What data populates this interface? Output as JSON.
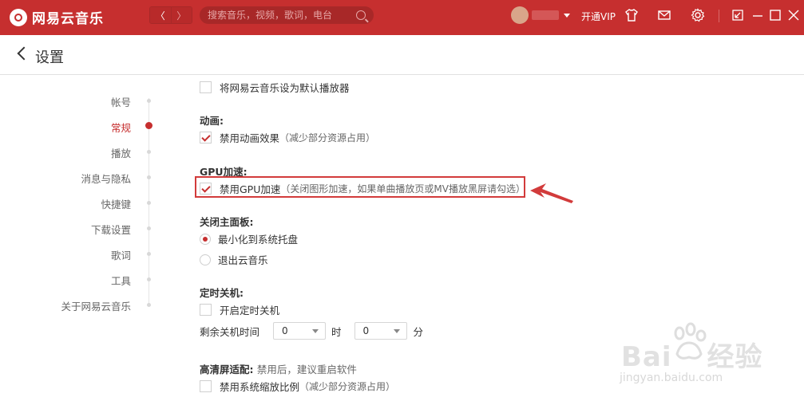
{
  "titlebar": {
    "app_name": "网易云音乐",
    "back_label": "〈",
    "forward_label": "〉",
    "search_placeholder": "搜索音乐，视频，歌词，电台",
    "vip_label": "开通VIP",
    "icons": [
      "shirt-icon",
      "mail-icon",
      "gear-icon",
      "mini-mode-icon",
      "minimize-icon",
      "maximize-icon",
      "close-icon"
    ],
    "accent_color": "#c62f2f"
  },
  "header": {
    "title": "设置"
  },
  "sidenav": {
    "items": [
      {
        "label": "帐号",
        "active": false
      },
      {
        "label": "常规",
        "active": true
      },
      {
        "label": "播放",
        "active": false
      },
      {
        "label": "消息与隐私",
        "active": false
      },
      {
        "label": "快捷键",
        "active": false
      },
      {
        "label": "下载设置",
        "active": false
      },
      {
        "label": "歌词",
        "active": false
      },
      {
        "label": "工具",
        "active": false
      },
      {
        "label": "关于网易云音乐",
        "active": false
      }
    ]
  },
  "settings": {
    "default_player": {
      "label": "将网易云音乐设为默认播放器",
      "checked": false
    },
    "animation": {
      "title": "动画:",
      "option": {
        "label": "禁用动画效果",
        "hint": "（减少部分资源占用）",
        "checked": true
      }
    },
    "gpu": {
      "title": "GPU加速:",
      "option": {
        "label": "禁用GPU加速",
        "hint": "（关闭图形加速，如果单曲播放页或MV播放黑屏请勾选）",
        "checked": true
      }
    },
    "close_panel": {
      "title": "关闭主面板:",
      "options": [
        {
          "label": "最小化到系统托盘",
          "checked": true
        },
        {
          "label": "退出云音乐",
          "checked": false
        }
      ]
    },
    "shutdown": {
      "title": "定时关机:",
      "enable": {
        "label": "开启定时关机",
        "checked": false
      },
      "remaining_label": "剩余关机时间",
      "hours_value": "0",
      "hours_unit": "时",
      "minutes_value": "0",
      "minutes_unit": "分"
    },
    "hidpi": {
      "title": "高清屏适配:",
      "note": "禁用后，建议重启软件",
      "option": {
        "label": "禁用系统缩放比例",
        "hint": "（减少部分资源占用）",
        "checked": false
      }
    }
  },
  "watermark": {
    "text": "Bai",
    "text2": "经验",
    "url": "jingyan.baidu.com"
  }
}
